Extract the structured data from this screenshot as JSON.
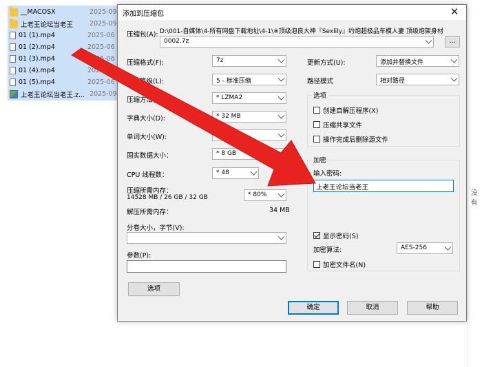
{
  "file_list": {
    "rows": [
      {
        "name": "__MACOSX",
        "date": "2025-09",
        "icon": "folder-icon"
      },
      {
        "name": "上老王论坛当老王",
        "date": "2025-09",
        "icon": "folder-icon"
      },
      {
        "name": "01 (1).mp4",
        "date": "2025-06",
        "icon": "file-icon"
      },
      {
        "name": "01 (2).mp4",
        "date": "2025-06",
        "icon": "file-icon"
      },
      {
        "name": "01 (3).mp4",
        "date": "2025-06",
        "icon": "file-icon"
      },
      {
        "name": "01 (4).mp4",
        "date": "2025-06",
        "icon": "file-icon"
      },
      {
        "name": "01 (5).mp4",
        "date": "2025-06",
        "icon": "file-icon"
      },
      {
        "name": "上老王论坛当老王.z...",
        "date": "2025-09",
        "icon": "zip-icon"
      }
    ],
    "side_text": "没有"
  },
  "dialog": {
    "title": "添加到压缩包",
    "close": "✕",
    "archive_label": "压缩包(A):",
    "archive_path": "D:\\001-自媒体\\4-所有网盘下载地址\\4-1\\※顶级泡良大神『Sexlily』约炮超极品车模人妻 顶级炮架身材",
    "archive_name": "0002.7z",
    "browse": "...",
    "format_label": "压缩格式(F):",
    "format_value": "7z",
    "level_label": "压缩等级(L):",
    "level_value": "5 - 标准压缩",
    "method_label": "压缩方法(M):",
    "method_value": "* LZMA2",
    "dict_label": "字典大小(D):",
    "dict_value": "* 32 MB",
    "word_label": "单词大小(W):",
    "word_value": "* 32",
    "solid_label": "固实数据大小：",
    "solid_value": "* 8 GB",
    "cpu_label": "CPU 线程数：",
    "cpu_value": "* 48",
    "mem_label": "压缩所需内存：",
    "mem_value": "14528 MB / 26 GB / 32 GB",
    "mem_pct": "* 80%",
    "decomp_label": "解压所需内存：",
    "decomp_value": "34 MB",
    "split_label": "分卷大小，字节(V):",
    "split_value": "",
    "params_label": "参数(P):",
    "params_value": "",
    "options_button": "选项",
    "update_label": "更新方式(U):",
    "update_value": "添加并替换文件",
    "path_label": "路径模式",
    "path_value": "相对路径",
    "options_group": "选项",
    "opt_sfx": "创建自解压程序(X)",
    "opt_shared": "压缩共享文件",
    "opt_delete": "操作完成后删除源文件",
    "encrypt_group": "加密",
    "password_label": "输入密码:",
    "password_value": "上老王论坛当老王",
    "show_password": "显示密码(S)",
    "algo_label": "加密算法:",
    "algo_value": "AES-256",
    "encrypt_names": "加密文件名(N)",
    "ok": "确定",
    "cancel": "取消",
    "help": "帮助"
  },
  "colors": {
    "arrow": "#e8231f",
    "selection": "#cce0f7",
    "accent": "#0078d7"
  }
}
